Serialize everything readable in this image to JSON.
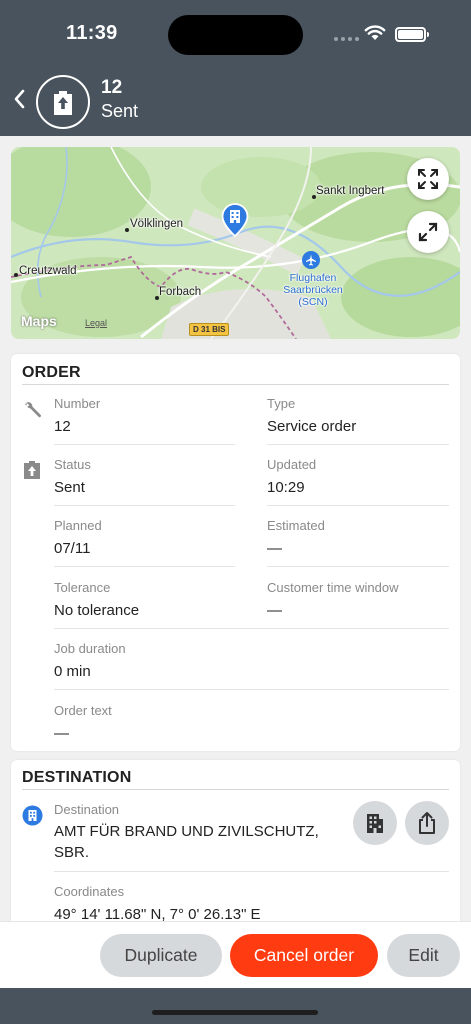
{
  "status_bar": {
    "time": "11:39"
  },
  "header": {
    "number": "12",
    "status": "Sent"
  },
  "map": {
    "labels": {
      "sankt_ingbert": "Sankt Ingbert",
      "volklingen": "Völklingen",
      "creutzwald": "Creutzwald",
      "forbach": "Forbach",
      "airport": "Flughafen Saarbrücken (SCN)",
      "road": "D 31 BIS",
      "maps": "Maps",
      "legal": "Legal"
    }
  },
  "order": {
    "title": "ORDER",
    "number_label": "Number",
    "number_value": "12",
    "type_label": "Type",
    "type_value": "Service order",
    "status_label": "Status",
    "status_value": "Sent",
    "updated_label": "Updated",
    "updated_value": "10:29",
    "planned_label": "Planned",
    "planned_value": "07/11",
    "estimated_label": "Estimated",
    "estimated_value": "—",
    "tolerance_label": "Tolerance",
    "tolerance_value": "No tolerance",
    "ctw_label": "Customer time window",
    "ctw_value": "—",
    "duration_label": "Job duration",
    "duration_value": "0 min",
    "text_label": "Order text",
    "text_value": "—"
  },
  "destination": {
    "title": "DESTINATION",
    "dest_label": "Destination",
    "dest_value": "AMT FÜR BRAND UND ZIVILSCHUTZ, SBR.",
    "coords_label": "Coordinates",
    "coords_value": "49° 14' 11.68\" N, 7° 0' 26.13\" E"
  },
  "actions": {
    "duplicate": "Duplicate",
    "cancel": "Cancel order",
    "edit": "Edit"
  },
  "colors": {
    "header": "#48535d",
    "accent_red": "#ff3b12",
    "map_blue": "#2d7be0",
    "grey_button": "#d6d9dc"
  },
  "icons": [
    "back-chevron-icon",
    "order-sent-icon",
    "fullscreen-icon",
    "expand-icon",
    "wrench-icon",
    "status-upload-icon",
    "building-icon",
    "share-icon",
    "airport-icon",
    "location-pin-icon"
  ]
}
